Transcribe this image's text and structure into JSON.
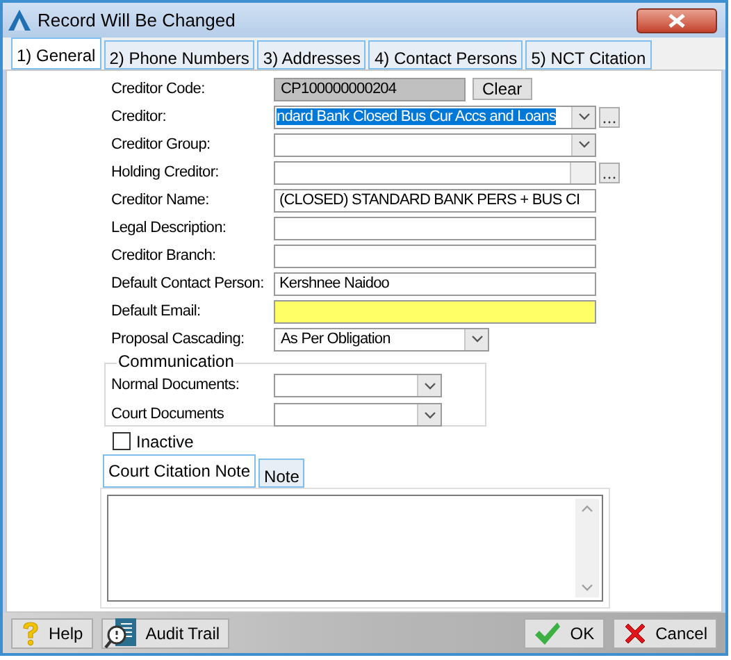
{
  "window": {
    "title": "Record Will Be Changed"
  },
  "tabs": [
    {
      "label": "1) General",
      "selected": true
    },
    {
      "label": "2) Phone Numbers",
      "selected": false
    },
    {
      "label": "3) Addresses",
      "selected": false
    },
    {
      "label": "4) Contact Persons",
      "selected": false
    },
    {
      "label": "5) NCT Citation",
      "selected": false
    }
  ],
  "fields": [
    {
      "label": "Creditor Code:",
      "kind": "readonly",
      "value": "CP100000000204",
      "button": "Clear"
    },
    {
      "label": "Creditor:",
      "kind": "combo",
      "value": "ndard Bank Closed Bus Cur Accs and Loans",
      "selected": true,
      "browse": true
    },
    {
      "label": "Creditor Group:",
      "kind": "combo",
      "browse": false
    },
    {
      "label": "Holding Creditor:",
      "kind": "lookup",
      "browse": true
    },
    {
      "label": "Creditor Name:",
      "kind": "text",
      "value": "(CLOSED) STANDARD BANK PERS + BUS CI"
    },
    {
      "label": "Legal Description:",
      "kind": "text"
    },
    {
      "label": "Creditor Branch:",
      "kind": "text"
    },
    {
      "label": "Default Contact Person:",
      "kind": "text",
      "value": "Kershnee Naidoo"
    },
    {
      "label": "Default Email:",
      "kind": "text",
      "required": true
    },
    {
      "label": "Proposal Cascading:",
      "kind": "short-combo",
      "value": "As Per Obligation"
    }
  ],
  "communication": {
    "title": "Communication",
    "fields": [
      {
        "label": "Normal Documents:"
      },
      {
        "label": "Court Documents"
      }
    ]
  },
  "inactive": {
    "label": "Inactive",
    "checked": false
  },
  "note_tabs": [
    {
      "label": "Court Citation Note",
      "selected": true
    },
    {
      "label": "Note",
      "selected": false
    }
  ],
  "buttons": [
    {
      "kind": "help",
      "label": "Help"
    },
    {
      "kind": "audit",
      "label": "Audit Trail"
    },
    {
      "kind": "ok",
      "label": "OK"
    },
    {
      "kind": "cancel",
      "label": "Cancel"
    }
  ]
}
